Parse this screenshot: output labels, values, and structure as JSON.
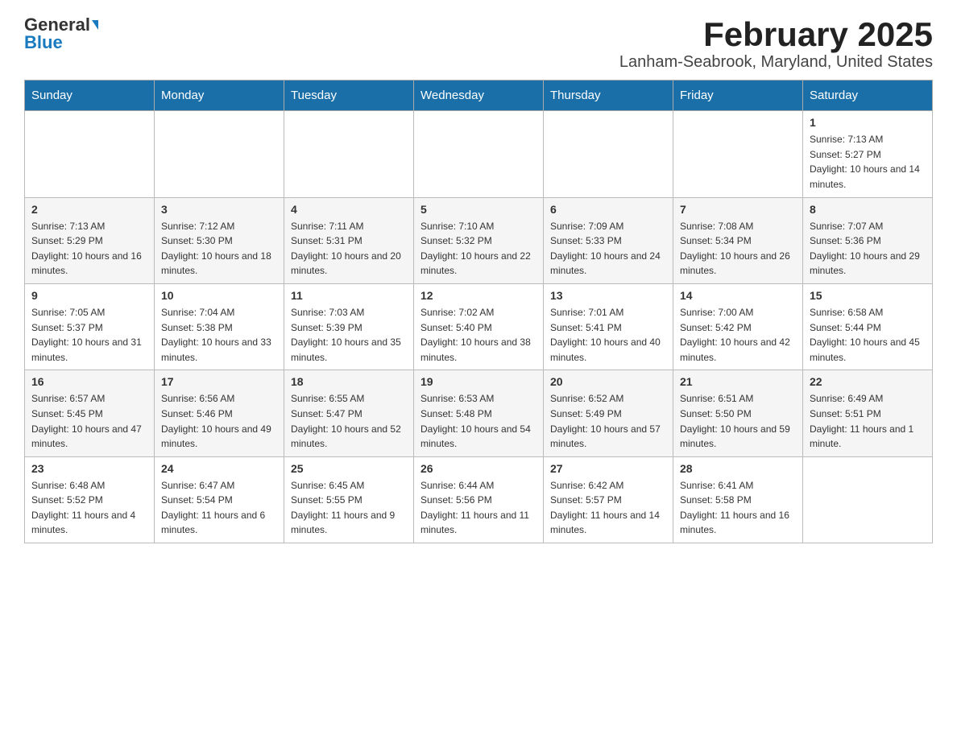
{
  "logo": {
    "general": "General",
    "blue": "Blue"
  },
  "title": "February 2025",
  "subtitle": "Lanham-Seabrook, Maryland, United States",
  "weekdays": [
    "Sunday",
    "Monday",
    "Tuesday",
    "Wednesday",
    "Thursday",
    "Friday",
    "Saturday"
  ],
  "weeks": [
    [
      {
        "day": "",
        "sunrise": "",
        "sunset": "",
        "daylight": ""
      },
      {
        "day": "",
        "sunrise": "",
        "sunset": "",
        "daylight": ""
      },
      {
        "day": "",
        "sunrise": "",
        "sunset": "",
        "daylight": ""
      },
      {
        "day": "",
        "sunrise": "",
        "sunset": "",
        "daylight": ""
      },
      {
        "day": "",
        "sunrise": "",
        "sunset": "",
        "daylight": ""
      },
      {
        "day": "",
        "sunrise": "",
        "sunset": "",
        "daylight": ""
      },
      {
        "day": "1",
        "sunrise": "Sunrise: 7:13 AM",
        "sunset": "Sunset: 5:27 PM",
        "daylight": "Daylight: 10 hours and 14 minutes."
      }
    ],
    [
      {
        "day": "2",
        "sunrise": "Sunrise: 7:13 AM",
        "sunset": "Sunset: 5:29 PM",
        "daylight": "Daylight: 10 hours and 16 minutes."
      },
      {
        "day": "3",
        "sunrise": "Sunrise: 7:12 AM",
        "sunset": "Sunset: 5:30 PM",
        "daylight": "Daylight: 10 hours and 18 minutes."
      },
      {
        "day": "4",
        "sunrise": "Sunrise: 7:11 AM",
        "sunset": "Sunset: 5:31 PM",
        "daylight": "Daylight: 10 hours and 20 minutes."
      },
      {
        "day": "5",
        "sunrise": "Sunrise: 7:10 AM",
        "sunset": "Sunset: 5:32 PM",
        "daylight": "Daylight: 10 hours and 22 minutes."
      },
      {
        "day": "6",
        "sunrise": "Sunrise: 7:09 AM",
        "sunset": "Sunset: 5:33 PM",
        "daylight": "Daylight: 10 hours and 24 minutes."
      },
      {
        "day": "7",
        "sunrise": "Sunrise: 7:08 AM",
        "sunset": "Sunset: 5:34 PM",
        "daylight": "Daylight: 10 hours and 26 minutes."
      },
      {
        "day": "8",
        "sunrise": "Sunrise: 7:07 AM",
        "sunset": "Sunset: 5:36 PM",
        "daylight": "Daylight: 10 hours and 29 minutes."
      }
    ],
    [
      {
        "day": "9",
        "sunrise": "Sunrise: 7:05 AM",
        "sunset": "Sunset: 5:37 PM",
        "daylight": "Daylight: 10 hours and 31 minutes."
      },
      {
        "day": "10",
        "sunrise": "Sunrise: 7:04 AM",
        "sunset": "Sunset: 5:38 PM",
        "daylight": "Daylight: 10 hours and 33 minutes."
      },
      {
        "day": "11",
        "sunrise": "Sunrise: 7:03 AM",
        "sunset": "Sunset: 5:39 PM",
        "daylight": "Daylight: 10 hours and 35 minutes."
      },
      {
        "day": "12",
        "sunrise": "Sunrise: 7:02 AM",
        "sunset": "Sunset: 5:40 PM",
        "daylight": "Daylight: 10 hours and 38 minutes."
      },
      {
        "day": "13",
        "sunrise": "Sunrise: 7:01 AM",
        "sunset": "Sunset: 5:41 PM",
        "daylight": "Daylight: 10 hours and 40 minutes."
      },
      {
        "day": "14",
        "sunrise": "Sunrise: 7:00 AM",
        "sunset": "Sunset: 5:42 PM",
        "daylight": "Daylight: 10 hours and 42 minutes."
      },
      {
        "day": "15",
        "sunrise": "Sunrise: 6:58 AM",
        "sunset": "Sunset: 5:44 PM",
        "daylight": "Daylight: 10 hours and 45 minutes."
      }
    ],
    [
      {
        "day": "16",
        "sunrise": "Sunrise: 6:57 AM",
        "sunset": "Sunset: 5:45 PM",
        "daylight": "Daylight: 10 hours and 47 minutes."
      },
      {
        "day": "17",
        "sunrise": "Sunrise: 6:56 AM",
        "sunset": "Sunset: 5:46 PM",
        "daylight": "Daylight: 10 hours and 49 minutes."
      },
      {
        "day": "18",
        "sunrise": "Sunrise: 6:55 AM",
        "sunset": "Sunset: 5:47 PM",
        "daylight": "Daylight: 10 hours and 52 minutes."
      },
      {
        "day": "19",
        "sunrise": "Sunrise: 6:53 AM",
        "sunset": "Sunset: 5:48 PM",
        "daylight": "Daylight: 10 hours and 54 minutes."
      },
      {
        "day": "20",
        "sunrise": "Sunrise: 6:52 AM",
        "sunset": "Sunset: 5:49 PM",
        "daylight": "Daylight: 10 hours and 57 minutes."
      },
      {
        "day": "21",
        "sunrise": "Sunrise: 6:51 AM",
        "sunset": "Sunset: 5:50 PM",
        "daylight": "Daylight: 10 hours and 59 minutes."
      },
      {
        "day": "22",
        "sunrise": "Sunrise: 6:49 AM",
        "sunset": "Sunset: 5:51 PM",
        "daylight": "Daylight: 11 hours and 1 minute."
      }
    ],
    [
      {
        "day": "23",
        "sunrise": "Sunrise: 6:48 AM",
        "sunset": "Sunset: 5:52 PM",
        "daylight": "Daylight: 11 hours and 4 minutes."
      },
      {
        "day": "24",
        "sunrise": "Sunrise: 6:47 AM",
        "sunset": "Sunset: 5:54 PM",
        "daylight": "Daylight: 11 hours and 6 minutes."
      },
      {
        "day": "25",
        "sunrise": "Sunrise: 6:45 AM",
        "sunset": "Sunset: 5:55 PM",
        "daylight": "Daylight: 11 hours and 9 minutes."
      },
      {
        "day": "26",
        "sunrise": "Sunrise: 6:44 AM",
        "sunset": "Sunset: 5:56 PM",
        "daylight": "Daylight: 11 hours and 11 minutes."
      },
      {
        "day": "27",
        "sunrise": "Sunrise: 6:42 AM",
        "sunset": "Sunset: 5:57 PM",
        "daylight": "Daylight: 11 hours and 14 minutes."
      },
      {
        "day": "28",
        "sunrise": "Sunrise: 6:41 AM",
        "sunset": "Sunset: 5:58 PM",
        "daylight": "Daylight: 11 hours and 16 minutes."
      },
      {
        "day": "",
        "sunrise": "",
        "sunset": "",
        "daylight": ""
      }
    ]
  ]
}
